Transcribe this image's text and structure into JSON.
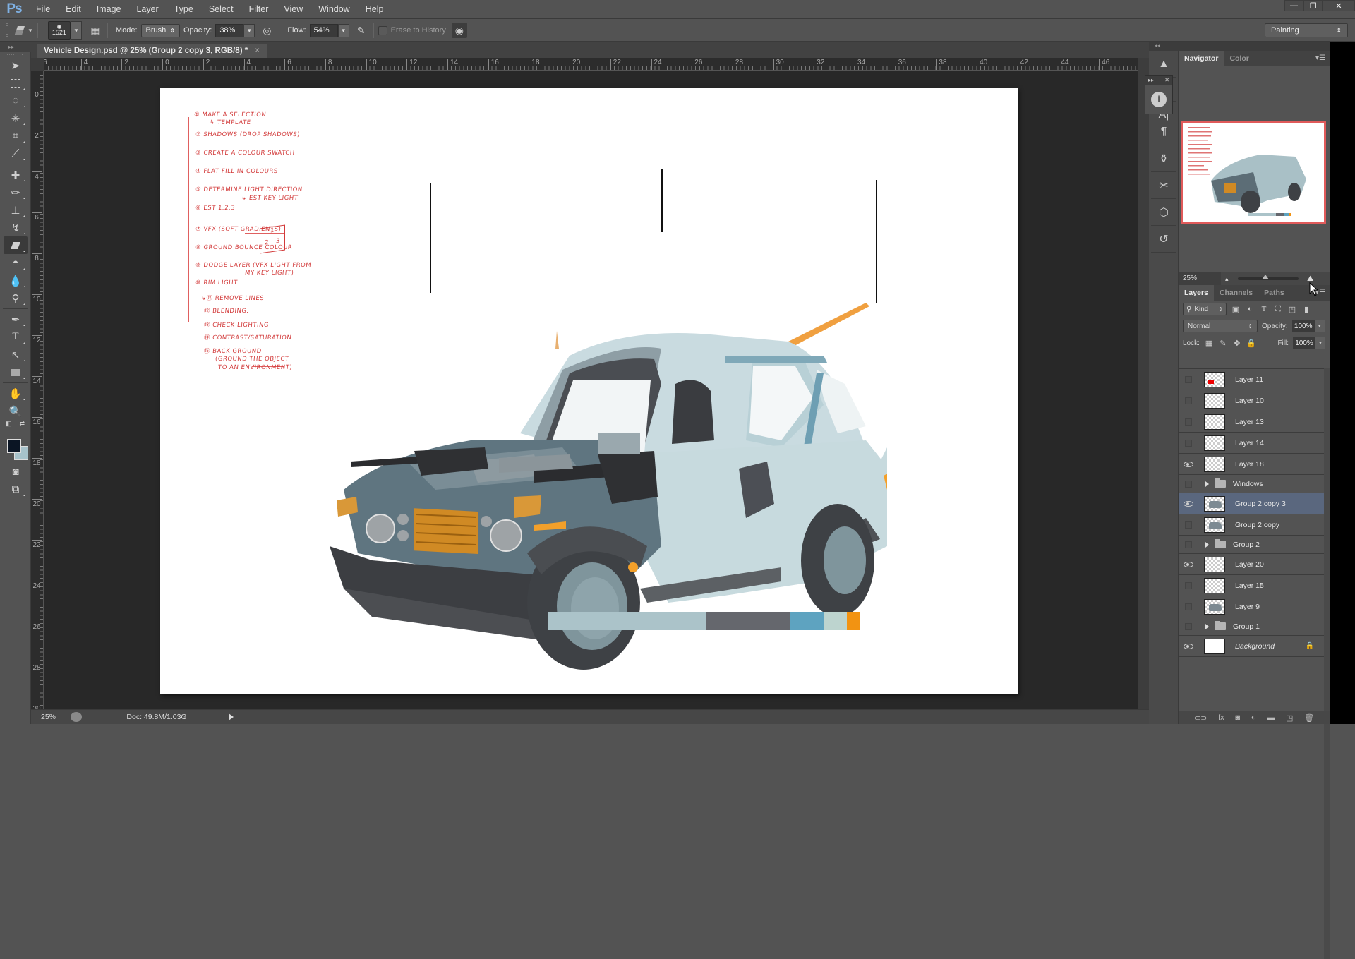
{
  "app": {
    "logo": "Ps",
    "window_controls": {
      "minimize": "—",
      "restore": "❐",
      "close": "✕"
    }
  },
  "menu": [
    "File",
    "Edit",
    "Image",
    "Layer",
    "Type",
    "Select",
    "Filter",
    "View",
    "Window",
    "Help"
  ],
  "options_bar": {
    "tool_icon": "eraser-icon",
    "brush_size": "1521",
    "mode_label": "Mode:",
    "mode_value": "Brush",
    "opacity_label": "Opacity:",
    "opacity_value": "38%",
    "flow_label": "Flow:",
    "flow_value": "54%",
    "erase_to_history_label": "Erase to History",
    "erase_to_history_checked": false,
    "workspace": "Painting"
  },
  "document": {
    "tab_title": "Vehicle Design.psd @ 25% (Group 2 copy 3, RGB/8) *",
    "tab_close": "×",
    "ruler_h_labels": [
      "6",
      "4",
      "2",
      "0",
      "2",
      "4",
      "6",
      "8",
      "10",
      "12",
      "14",
      "16",
      "18",
      "20",
      "22",
      "24",
      "26",
      "28",
      "30",
      "32",
      "34",
      "36",
      "38",
      "40",
      "42",
      "44",
      "46"
    ],
    "ruler_v_labels": [
      "0",
      "2",
      "4",
      "6",
      "8",
      "10",
      "12",
      "14",
      "16",
      "18",
      "20",
      "22",
      "24",
      "26",
      "28",
      "30"
    ],
    "notes": [
      "① MAKE A SELECTION",
      "↳ TEMPLATE",
      "② SHADOWS (DROP SHADOWS)",
      "③ CREATE A COLOUR SWATCH",
      "④ FLAT FILL IN COLOURS",
      "⑤ DETERMINE LIGHT DIRECTION",
      "↳ EST KEY LIGHT",
      "⑥ EST 1.2.3",
      "⑦ VFX (SOFT GRADIENTS)",
      "⑧ GROUND BOUNCE COLOUR",
      "⑨ DODGE LAYER (VFX LIGHT FROM",
      "MY KEY LIGHT)",
      "⑩ RIM LIGHT",
      "↳⑪ REMOVE LINES",
      "⑫ BLENDING.",
      "⑬ CHECK LIGHTING",
      "⑭ CONTRAST/SATURATION",
      "⑮ BACK GROUND",
      "(GROUND THE OBJECT",
      "TO AN ENVIRONMENT)"
    ],
    "cube_labels": [
      "1",
      "2",
      "3"
    ],
    "palette": [
      {
        "color": "#abc3c9",
        "weight": 0.51
      },
      {
        "color": "#65676d",
        "weight": 0.265
      },
      {
        "color": "#5ea3c0",
        "weight": 0.11
      },
      {
        "color": "#bdd4cf",
        "weight": 0.075
      },
      {
        "color": "#f29312",
        "weight": 0.04
      }
    ]
  },
  "tools": [
    "move-tool",
    "marquee-tool",
    "lasso-tool",
    "magic-wand-tool",
    "crop-tool",
    "eyedropper-tool",
    "healing-brush-tool",
    "brush-tool",
    "clone-stamp-tool",
    "history-brush-tool",
    "eraser-tool",
    "paint-bucket-tool",
    "blur-tool",
    "dodge-tool",
    "pen-tool",
    "type-tool",
    "path-selection-tool",
    "rectangle-tool",
    "hand-rotate-tool",
    "zoom-tool"
  ],
  "colors": {
    "foreground": "#0b1524",
    "background": "#a7c2ca"
  },
  "status": {
    "zoom": "25%",
    "doc": "Doc: 49.8M/1.03G"
  },
  "navigator": {
    "tabs": [
      "Navigator",
      "Color"
    ],
    "active_tab": "Navigator",
    "zoom": "25%"
  },
  "layers_panel": {
    "tabs": [
      "Layers",
      "Channels",
      "Paths"
    ],
    "active_tab": "Layers",
    "filter_kind": "Kind",
    "blend_mode": "Normal",
    "opacity_label": "Opacity:",
    "opacity_value": "100%",
    "lock_label": "Lock:",
    "fill_label": "Fill:",
    "fill_value": "100%",
    "layers": [
      {
        "name": "Layer 11",
        "visible": false,
        "type": "layer",
        "thumb": "red"
      },
      {
        "name": "Layer 10",
        "visible": false,
        "type": "layer",
        "thumb": "trans"
      },
      {
        "name": "Layer 13",
        "visible": false,
        "type": "layer",
        "thumb": "trans"
      },
      {
        "name": "Layer 14",
        "visible": false,
        "type": "layer",
        "thumb": "trans"
      },
      {
        "name": "Layer 18",
        "visible": true,
        "type": "layer",
        "thumb": "trans"
      },
      {
        "name": "Windows",
        "visible": false,
        "type": "group"
      },
      {
        "name": "Group 2 copy 3",
        "visible": true,
        "type": "layer",
        "thumb": "car",
        "selected": true
      },
      {
        "name": "Group 2 copy",
        "visible": false,
        "type": "layer",
        "thumb": "car"
      },
      {
        "name": "Group 2",
        "visible": false,
        "type": "group"
      },
      {
        "name": "Layer 20",
        "visible": true,
        "type": "layer",
        "thumb": "trans"
      },
      {
        "name": "Layer 15",
        "visible": false,
        "type": "layer",
        "thumb": "trans"
      },
      {
        "name": "Layer 9",
        "visible": false,
        "type": "layer",
        "thumb": "car"
      },
      {
        "name": "Group 1",
        "visible": false,
        "type": "group"
      },
      {
        "name": "Background",
        "visible": true,
        "type": "background",
        "thumb": "white",
        "locked": true
      }
    ],
    "footer_icons": [
      "link-icon",
      "fx-icon",
      "mask-icon",
      "adjustment-icon",
      "folder-icon",
      "new-layer-icon",
      "trash-icon"
    ],
    "footer_labels": [
      "⊂⊃",
      "fx",
      "◙",
      "◐",
      "▬",
      "◳",
      "🗑"
    ]
  }
}
